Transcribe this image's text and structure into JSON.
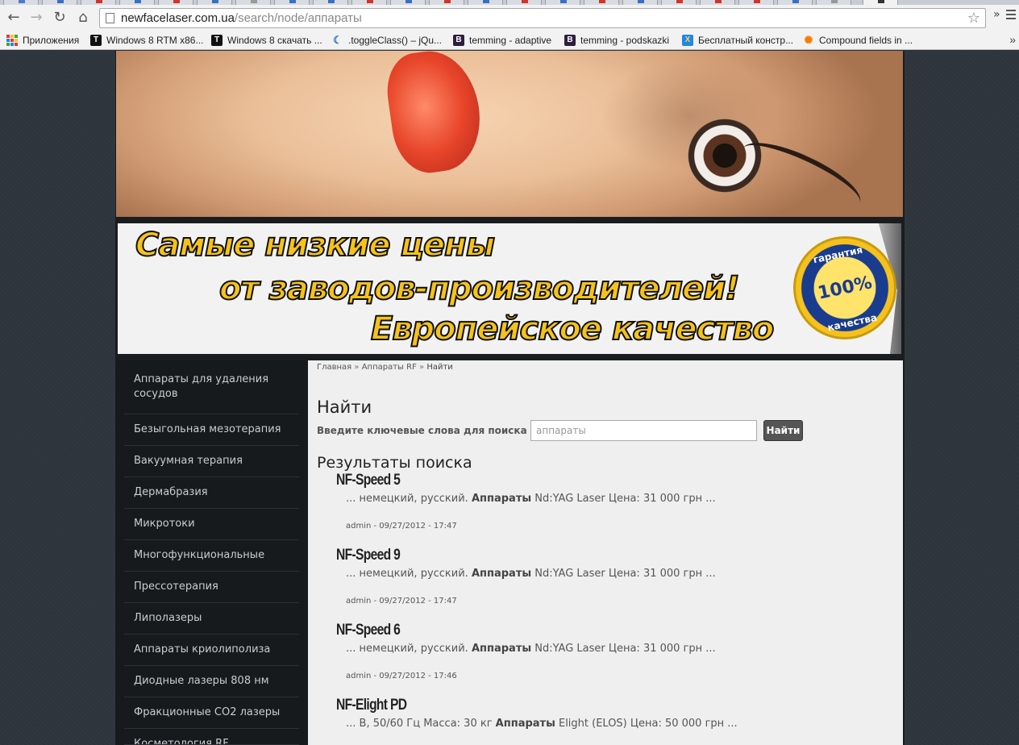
{
  "browser": {
    "url_host": "newfacelaser.com.ua",
    "url_path": "/search/node/аппараты",
    "more_label": "»",
    "bookmarks": [
      {
        "label": "Приложения",
        "icon": "apps-grid-icon"
      },
      {
        "label": "Windows 8 RTM x86...",
        "icon": "t-logo-icon"
      },
      {
        "label": "Windows 8 скачать ...",
        "icon": "t-logo-icon"
      },
      {
        "label": ".toggleClass() – jQu...",
        "icon": "jquery-icon"
      },
      {
        "label": "temming - adaptive",
        "icon": "b-logo-icon"
      },
      {
        "label": "temming - podskazki",
        "icon": "b-logo-icon"
      },
      {
        "label": "Бесплатный констр...",
        "icon": "x-logo-icon"
      },
      {
        "label": "Compound fields in ...",
        "icon": "drupal-icon"
      }
    ],
    "bookmarks_more": "»"
  },
  "promo": {
    "line1": "Самые низкие цены",
    "line2": "от заводов-производителей!",
    "line3": "Европейское качество",
    "seal_top": "гарантия",
    "seal_value": "100%",
    "seal_bottom": "качества"
  },
  "sidebar": {
    "items": [
      "Аппараты для удаления сосудов",
      "Безыгольная мезотерапия",
      "Вакуумная терапия",
      "Дермабразия",
      "Микротоки",
      "Многофункциональные",
      "Прессотерапия",
      "Липолазеры",
      "Аппараты криолиполиза",
      "Диодные лазеры 808 нм",
      "Фракционные CO2 лазеры",
      "Косметология RF"
    ]
  },
  "breadcrumb": {
    "home": "Главная",
    "sep": "»",
    "section": "Аппараты RF",
    "current": "Найти"
  },
  "search": {
    "title": "Найти",
    "label": "Введите ключевые слова для поиска",
    "value": "аппараты",
    "button": "Найти",
    "results_title": "Результаты поиска"
  },
  "results": [
    {
      "title": "NF-Speed 5",
      "pre": "... немецкий, русский. ",
      "hl": "Аппараты",
      "post": " Nd:YAG Laser Цена: 31 000 грн ...",
      "meta": "admin - 09/27/2012 - 17:47"
    },
    {
      "title": "NF-Speed 9",
      "pre": "... немецкий, русский. ",
      "hl": "Аппараты",
      "post": " Nd:YAG Laser Цена: 31 000 грн ...",
      "meta": "admin - 09/27/2012 - 17:47"
    },
    {
      "title": "NF-Speed 6",
      "pre": "... немецкий, русский. ",
      "hl": "Аппараты",
      "post": " Nd:YAG Laser Цена: 31 000 грн ...",
      "meta": "admin - 09/27/2012 - 17:46"
    },
    {
      "title": "NF-Elight PD",
      "pre": "... В, 50/60 Гц Масса: 30 кг ",
      "hl": "Аппараты",
      "post": " Elight (ELOS) Цена: 50 000 грн ...",
      "meta": ""
    }
  ],
  "colors": {
    "page_bg": "#2e343b",
    "sidebar_bg": "#171a1d",
    "content_bg": "#efefef",
    "promo_yellow": "#f6c21a",
    "button_bg": "#555555"
  }
}
